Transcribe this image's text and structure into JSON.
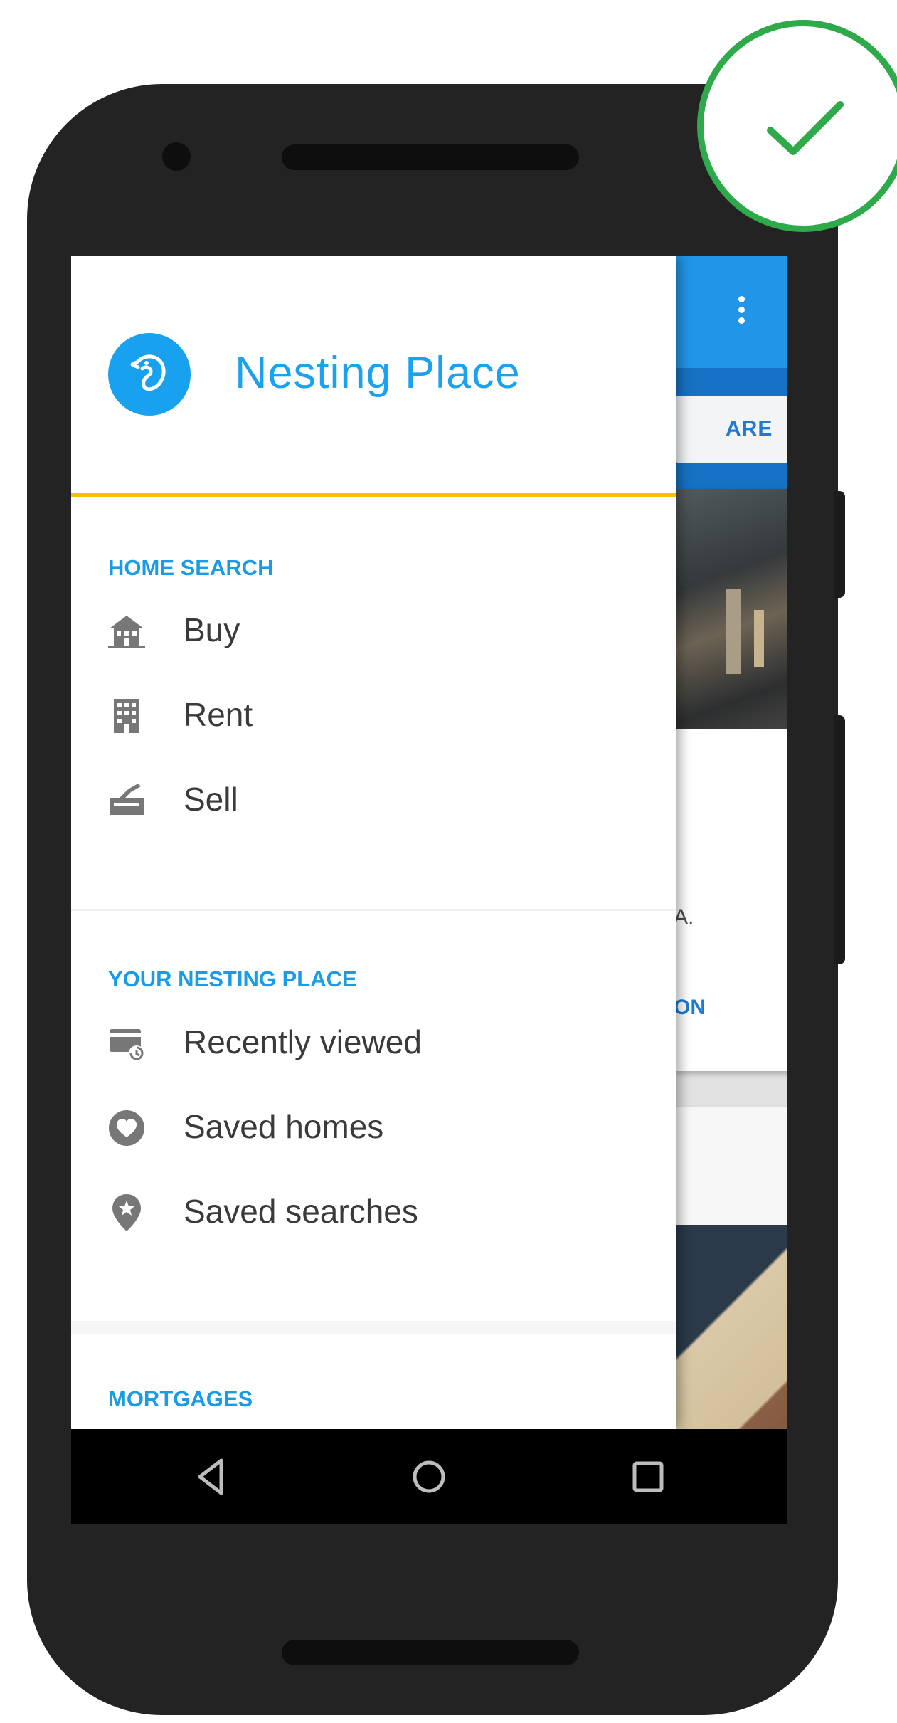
{
  "drawer": {
    "brand_name": "Nesting Place",
    "sections": [
      {
        "title": "HOME SEARCH",
        "items": [
          {
            "label": "Buy",
            "icon": "house-icon"
          },
          {
            "label": "Rent",
            "icon": "building-icon"
          },
          {
            "label": "Sell",
            "icon": "sell-sign-icon"
          }
        ]
      },
      {
        "title": "YOUR NESTING PLACE",
        "items": [
          {
            "label": "Recently viewed",
            "icon": "recently-viewed-icon"
          },
          {
            "label": "Saved homes",
            "icon": "heart-icon"
          },
          {
            "label": "Saved searches",
            "icon": "star-pin-icon"
          }
        ]
      },
      {
        "title": "MORTGAGES",
        "items": []
      }
    ]
  },
  "background_app": {
    "tab_text": "ARE",
    "card_text": "A.",
    "card_action": "ON"
  },
  "navbar": {
    "buttons": [
      "back-icon",
      "home-icon",
      "recents-icon"
    ]
  },
  "badge": {
    "icon": "checkmark-icon",
    "color": "#2eaa4a"
  },
  "colors": {
    "accent_blue": "#1ca1ef",
    "divider_yellow": "#f6c000",
    "toolbar_blue": "#2196e8"
  }
}
